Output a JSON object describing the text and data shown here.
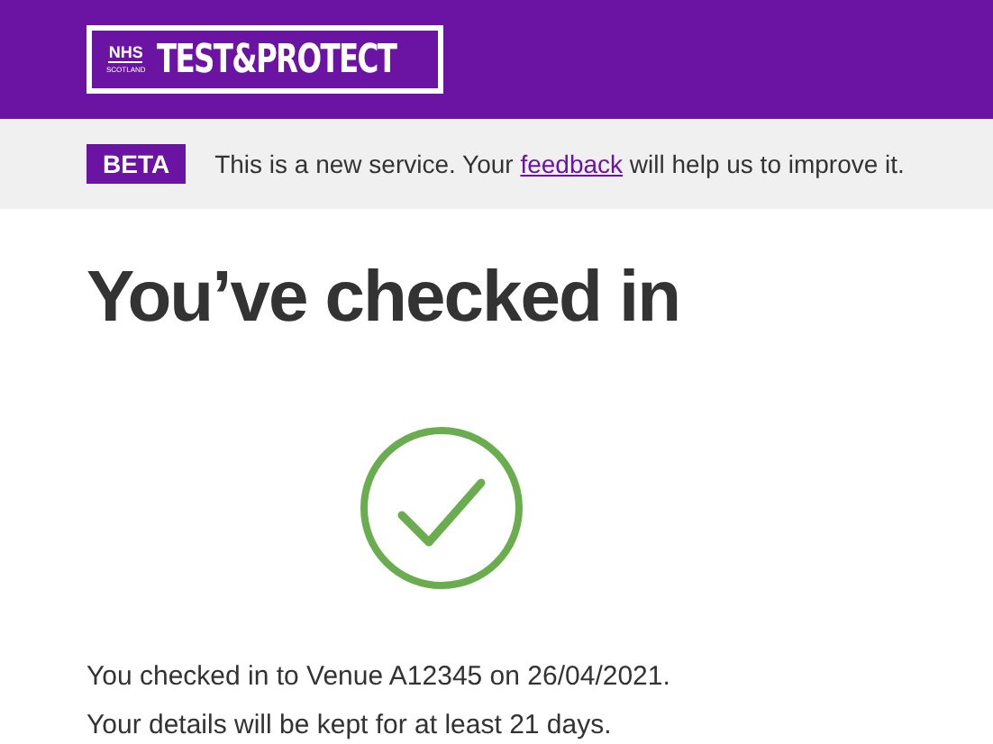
{
  "header": {
    "logo": {
      "small_top": "NHS",
      "small_bottom": "SCOTLAND",
      "main": "TEST&PROTECT"
    }
  },
  "banner": {
    "tag": "BETA",
    "text_before": "This is a new service. Your ",
    "link": "feedback",
    "text_after": " will help us to improve it."
  },
  "heading": "You’ve checked in",
  "messages": [
    "You checked in to Venue A12345 on 26/04/2021.",
    "Your details will be kept for at least 21 days."
  ]
}
